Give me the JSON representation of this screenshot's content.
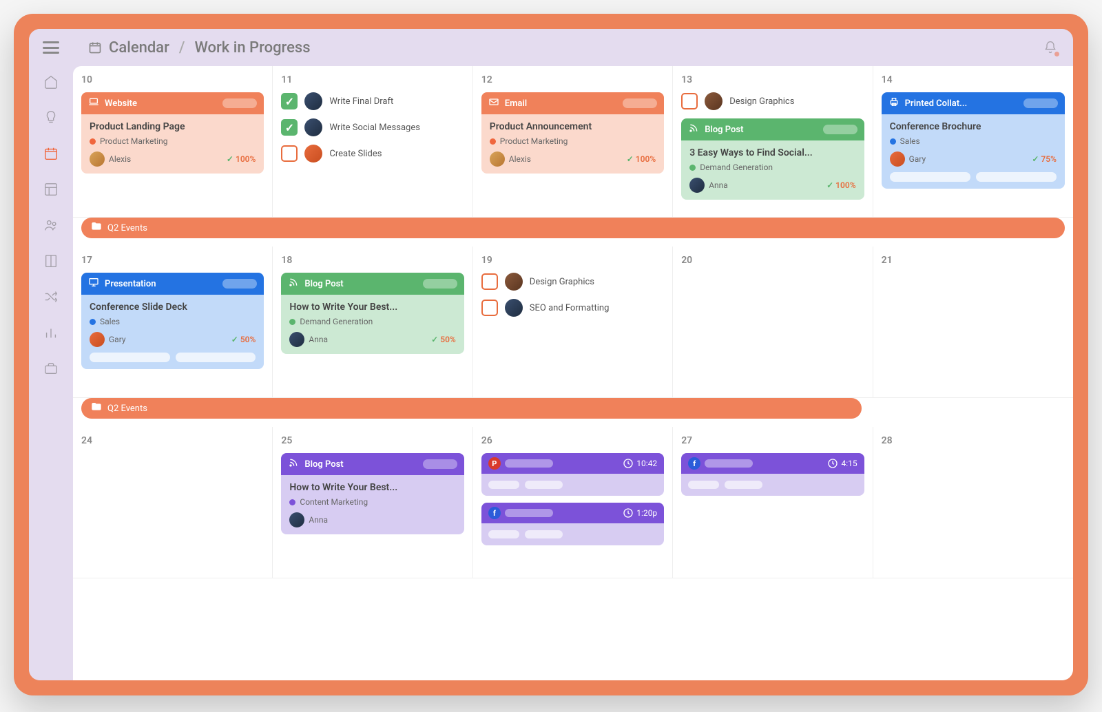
{
  "breadcrumb": {
    "root": "Calendar",
    "page": "Work in Progress"
  },
  "banner_label": "Q2 Events",
  "weeks": [
    {
      "days": [
        {
          "num": "10",
          "cards": [
            {
              "type": "content",
              "color": "orange",
              "icon": "laptop",
              "cat": "Website",
              "title": "Product Landing Page",
              "tag": "Product Marketing",
              "tag_color": "orange",
              "person": "Alexis",
              "avatar": "av3",
              "progress": "100%"
            }
          ]
        },
        {
          "num": "11",
          "tasks": [
            {
              "done": true,
              "avatar": "av2",
              "label": "Write Final Draft"
            },
            {
              "done": true,
              "avatar": "av2",
              "label": "Write Social Messages"
            },
            {
              "done": false,
              "avatar": "av4",
              "label": "Create Slides",
              "style": "empty"
            }
          ]
        },
        {
          "num": "12",
          "cards": [
            {
              "type": "content",
              "color": "orange",
              "icon": "email",
              "cat": "Email",
              "title": "Product Announcement",
              "tag": "Product Marketing",
              "tag_color": "orange",
              "person": "Alexis",
              "avatar": "av3",
              "progress": "100%"
            }
          ]
        },
        {
          "num": "13",
          "tasks": [
            {
              "done": false,
              "avatar": "av1",
              "label": "Design Graphics",
              "style": "empty"
            }
          ],
          "cards": [
            {
              "type": "content",
              "color": "green",
              "icon": "rss",
              "cat": "Blog Post",
              "title": "3 Easy Ways to Find Social...",
              "tag": "Demand Generation",
              "tag_color": "green",
              "person": "Anna",
              "avatar": "av2",
              "progress": "100%"
            }
          ]
        },
        {
          "num": "14",
          "cards": [
            {
              "type": "content",
              "color": "blue",
              "icon": "print",
              "cat": "Printed Collat...",
              "title": "Conference Brochure",
              "tag": "Sales",
              "tag_color": "blue",
              "person": "Gary",
              "avatar": "av4",
              "progress": "75%",
              "subtasks": true
            }
          ]
        }
      ],
      "banner": true
    },
    {
      "days": [
        {
          "num": "17",
          "cards": [
            {
              "type": "content",
              "color": "blue",
              "icon": "present",
              "cat": "Presentation",
              "title": "Conference Slide Deck",
              "tag": "Sales",
              "tag_color": "blue",
              "person": "Gary",
              "avatar": "av4",
              "progress": "50%",
              "subtasks": true
            }
          ]
        },
        {
          "num": "18",
          "cards": [
            {
              "type": "content",
              "color": "green",
              "icon": "rss",
              "cat": "Blog Post",
              "title": "How to Write Your Best...",
              "tag": "Demand Generation",
              "tag_color": "green",
              "person": "Anna",
              "avatar": "av2",
              "progress": "50%"
            }
          ]
        },
        {
          "num": "19",
          "tasks": [
            {
              "done": false,
              "avatar": "av1",
              "label": "Design Graphics",
              "style": "empty"
            },
            {
              "done": false,
              "avatar": "av2",
              "label": "SEO and Formatting",
              "style": "empty"
            }
          ]
        },
        {
          "num": "20"
        },
        {
          "num": "21"
        }
      ],
      "banner": true,
      "banner_width": "78%"
    },
    {
      "days": [
        {
          "num": "24"
        },
        {
          "num": "25",
          "cards": [
            {
              "type": "content",
              "color": "purple",
              "icon": "rss",
              "cat": "Blog Post",
              "title": "How to Write Your Best...",
              "tag": "Content Marketing",
              "tag_color": "purple",
              "person": "Anna",
              "avatar": "av2"
            }
          ]
        },
        {
          "num": "26",
          "social": [
            {
              "net": "pin",
              "time": "10:42"
            },
            {
              "net": "fb",
              "time": "1:20p"
            }
          ]
        },
        {
          "num": "27",
          "social": [
            {
              "net": "fb",
              "time": "4:15"
            }
          ]
        },
        {
          "num": "28"
        }
      ]
    }
  ]
}
